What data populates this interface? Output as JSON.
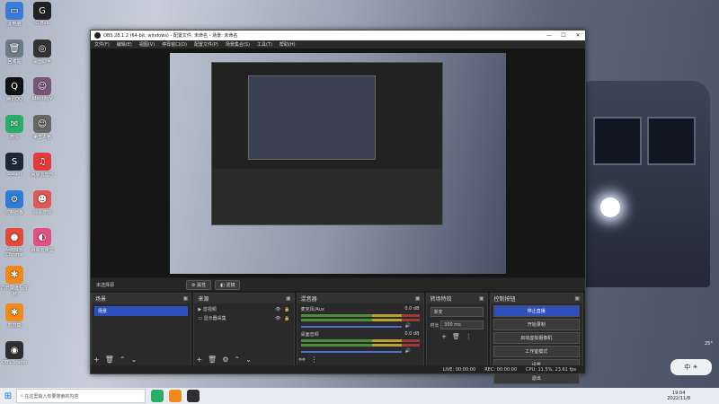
{
  "desktop": {
    "icons": [
      {
        "label": "此电脑",
        "color": "#3a7bd5",
        "glyph": "▭"
      },
      {
        "label": "回收站",
        "color": "#6c7a89",
        "glyph": "🗑"
      },
      {
        "label": "腾讯QQ",
        "color": "#111111",
        "glyph": "Q"
      },
      {
        "label": "微信",
        "color": "#2aae67",
        "glyph": "✉"
      },
      {
        "label": "Steam",
        "color": "#1b2838",
        "glyph": "S"
      },
      {
        "label": "控制面板",
        "color": "#2f7bd6",
        "glyph": "⚙"
      },
      {
        "label": "Google Chrome",
        "color": "#e24a3b",
        "glyph": "●"
      },
      {
        "label": "向日葵远程控制",
        "color": "#f08a1c",
        "glyph": "✱"
      },
      {
        "label": "向日葵",
        "color": "#f08a1c",
        "glyph": "✱"
      },
      {
        "label": "OBS Studio",
        "color": "#302e31",
        "glyph": "◉"
      }
    ],
    "icons2": [
      {
        "label": "G Hub",
        "color": "#222",
        "glyph": "G"
      },
      {
        "label": "桌面助手",
        "color": "#333",
        "glyph": "◎"
      },
      {
        "label": "IdentityV",
        "color": "#775577",
        "glyph": "☺"
      },
      {
        "label": "第五人格",
        "color": "#666",
        "glyph": "☺"
      },
      {
        "label": "网易云音乐",
        "color": "#e23b3b",
        "glyph": "♫"
      },
      {
        "label": "网易游戏",
        "color": "#e35656",
        "glyph": "☻"
      },
      {
        "label": "网易云课堂",
        "color": "#e05080",
        "glyph": "◐"
      }
    ]
  },
  "obs": {
    "title": "OBS 28.1.2 (64-bit, windows) - 配置文件: 未命名 - 场景: 未命名",
    "window_controls": [
      "—",
      "☐",
      "✕"
    ],
    "menu": [
      "文件(F)",
      "编辑(E)",
      "视图(V)",
      "停靠窗口(D)",
      "配置文件(P)",
      "场景集合(S)",
      "工具(T)",
      "帮助(H)"
    ],
    "source_bar": {
      "no_source": "未选择源",
      "properties": "属性",
      "filters": "滤镜"
    },
    "docks": {
      "scenes": {
        "title": "场景",
        "items": [
          "场景"
        ]
      },
      "sources": {
        "title": "来源",
        "items": [
          {
            "name": "音视频"
          },
          {
            "name": "显示器采集"
          }
        ]
      },
      "mixer": {
        "title": "混音器",
        "channels": [
          {
            "name": "麦克风/Aux",
            "db": "0.0 dB"
          },
          {
            "name": "桌面音频",
            "db": "0.0 dB"
          }
        ]
      },
      "transitions": {
        "title": "转场特效",
        "mode": "渐变",
        "duration_label": "时长",
        "duration": "300 ms"
      },
      "controls": {
        "title": "控制按钮",
        "buttons": [
          "停止直播",
          "开始录制",
          "启动虚拟摄像机",
          "工作室模式",
          "设置",
          "退出"
        ]
      }
    },
    "status": {
      "live": "LIVE: 00:00:00",
      "rec": "REC: 00:00:00",
      "cpu": "CPU: 11.5%, 23.61 fps"
    }
  },
  "taskbar": {
    "search_placeholder": "在这里输入你要搜索的内容",
    "time": "19:04",
    "date": "2022/11/8"
  },
  "weather": "25°",
  "ime": "中 ☀"
}
